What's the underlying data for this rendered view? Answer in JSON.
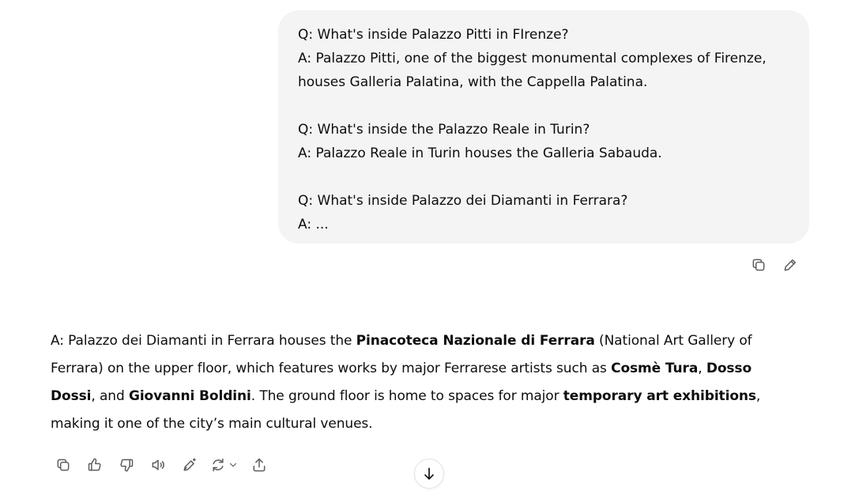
{
  "user_message": {
    "lines": [
      "Q: What's inside Palazzo Pitti in FIrenze?",
      "A: Palazzo Pitti, one of the biggest monumental complexes of Firenze,",
      "houses Galleria Palatina, with the Cappella Palatina.",
      "",
      "Q: What's inside the Palazzo Reale in Turin?",
      "A: Palazzo Reale in Turin houses the Galleria Sabauda.",
      "",
      "Q: What's inside Palazzo dei Diamanti in Ferrara?",
      "A: ..."
    ]
  },
  "user_actions": {
    "copy_icon": "copy-icon",
    "edit_icon": "pencil-icon"
  },
  "assistant_message": {
    "segments": [
      {
        "text": "A: Palazzo dei Diamanti in Ferrara houses the ",
        "bold": false
      },
      {
        "text": "Pinacoteca Nazionale di Ferrara",
        "bold": true
      },
      {
        "text": " (National Art Gallery of Ferrara) on the upper floor, which features works by major Ferrarese artists such as ",
        "bold": false
      },
      {
        "text": "Cosmè Tura",
        "bold": true
      },
      {
        "text": ", ",
        "bold": false
      },
      {
        "text": "Dosso Dossi",
        "bold": true
      },
      {
        "text": ", and ",
        "bold": false
      },
      {
        "text": "Giovanni Boldini",
        "bold": true
      },
      {
        "text": ". The ground floor is home to spaces for major ",
        "bold": false
      },
      {
        "text": "temporary art exhibitions",
        "bold": true
      },
      {
        "text": ", making it one of the city’s main cultural venues.",
        "bold": false
      }
    ]
  },
  "response_actions": [
    {
      "name": "copy-icon"
    },
    {
      "name": "thumbs-up-icon"
    },
    {
      "name": "thumbs-down-icon"
    },
    {
      "name": "read-aloud-icon"
    },
    {
      "name": "edit-magic-icon"
    },
    {
      "name": "regenerate-icon"
    },
    {
      "name": "share-icon"
    }
  ],
  "scroll_button": {
    "icon": "arrow-down-icon"
  }
}
